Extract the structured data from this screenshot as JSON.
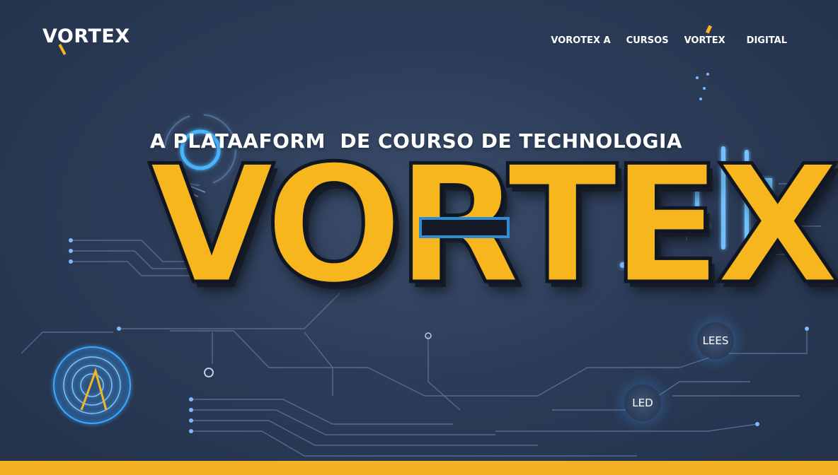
{
  "header": {
    "logo": "VORTEX",
    "nav": [
      {
        "label": "VOROTEX A"
      },
      {
        "label": "CURSOS"
      },
      {
        "label": "VORTEX"
      },
      {
        "label": "DIGITAL"
      }
    ]
  },
  "hero": {
    "tagline": "A PLATAAFORM  DE COURSO DE TECHNOLOGIA",
    "title": "VORTEX"
  },
  "badges": [
    "LEES",
    "LED"
  ],
  "colors": {
    "accent": "#f5b623",
    "background": "#2c3c58",
    "glow": "#3ea8ff"
  }
}
